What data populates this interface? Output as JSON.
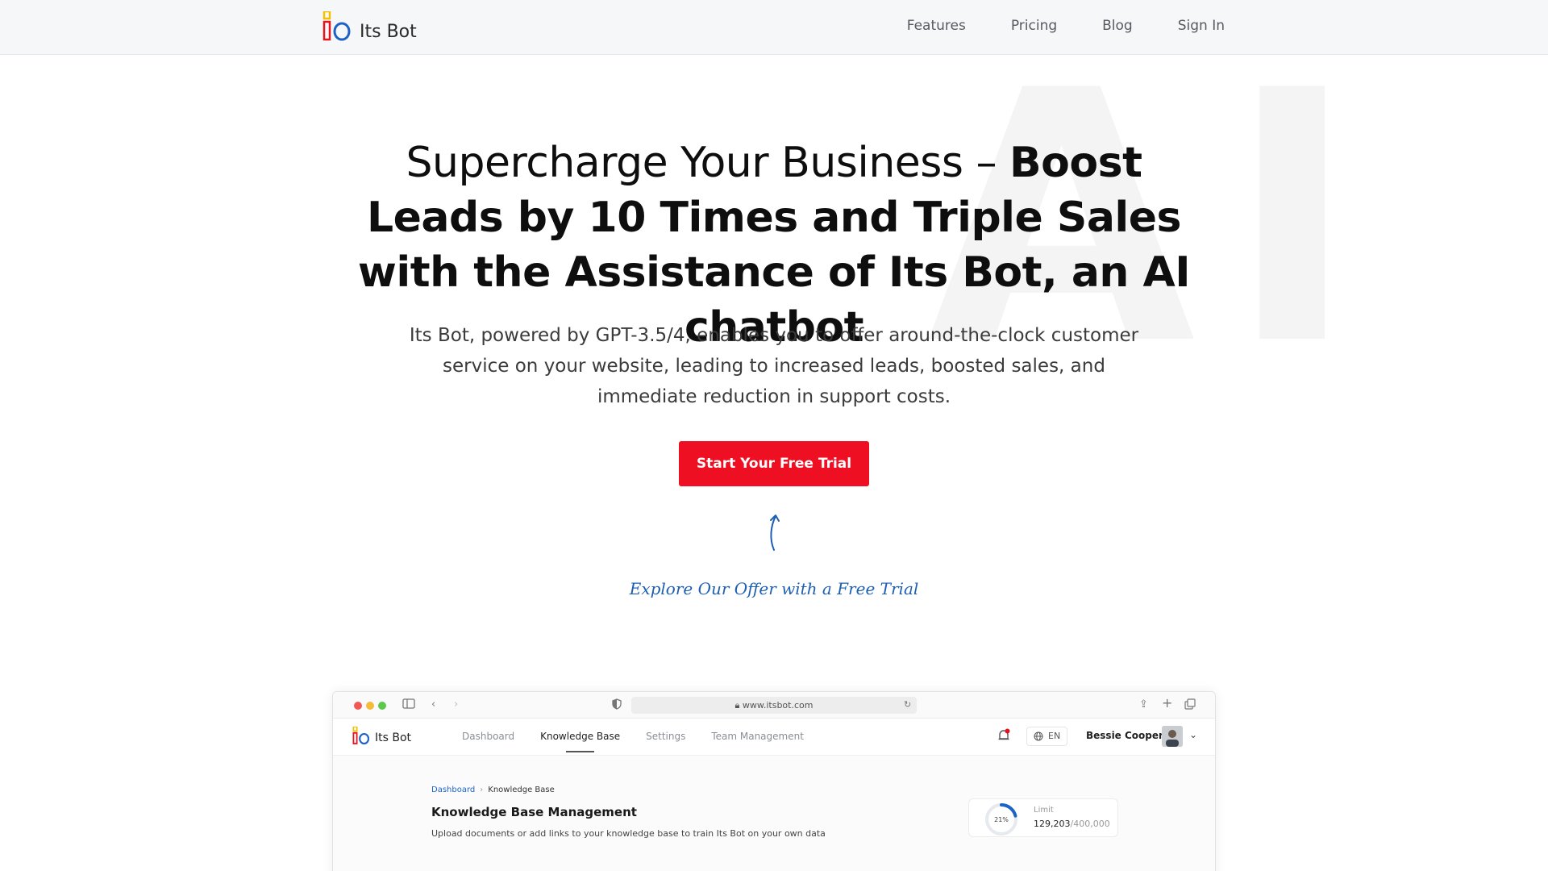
{
  "nav": {
    "brand": "Its Bot",
    "links": [
      "Features",
      "Pricing",
      "Blog",
      "Sign In"
    ]
  },
  "watermark": "AI",
  "hero": {
    "title_light": "Supercharge Your Business – ",
    "title_bold": "Boost Leads by 10 Times and Triple Sales with the Assistance of Its Bot, an AI chatbot",
    "subtitle": "Its Bot, powered by GPT-3.5/4, enables you to offer around-the-clock customer service on your website, leading to increased leads, boosted sales, and immediate reduction in support costs.",
    "cta_label": "Start Your Free Trial",
    "explore_text": "Explore Our Offer with a Free Trial"
  },
  "preview": {
    "url": "www.itsbot.com",
    "brand": "Its Bot",
    "tabs": [
      "Dashboard",
      "Knowledge Base",
      "Settings",
      "Team Management"
    ],
    "active_tab": "Knowledge Base",
    "language": "EN",
    "user_name": "Bessie Cooper",
    "breadcrumb": {
      "home": "Dashboard",
      "current": "Knowledge Base"
    },
    "page_title": "Knowledge Base Management",
    "page_desc": "Upload documents or add links to your knowledge base to train Its Bot on your own data",
    "limit": {
      "label": "Limit",
      "used": "129,203",
      "total": "/400,000",
      "percent_text": "21%",
      "percent": 21
    }
  },
  "colors": {
    "accent": "#ee0f22",
    "link_blue": "#1d63c5",
    "explore_blue": "#1d5fb3",
    "logo_yellow": "#f2c200",
    "logo_red": "#e4141f",
    "logo_blue": "#1d63c5"
  },
  "icons": [
    "logo-icon",
    "arrow-up-icon",
    "sidebar-icon",
    "back-icon",
    "forward-icon",
    "shield-icon",
    "lock-icon",
    "reload-icon",
    "share-icon",
    "plus-icon",
    "tabs-icon",
    "bell-icon",
    "globe-icon",
    "chevron-down-icon"
  ]
}
